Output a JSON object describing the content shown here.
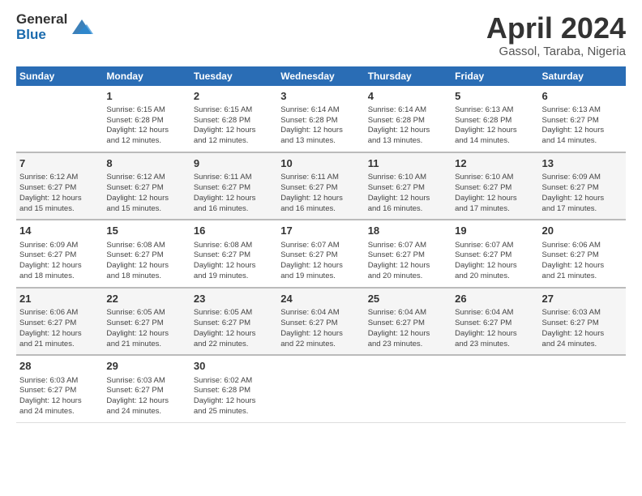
{
  "logo": {
    "general": "General",
    "blue": "Blue"
  },
  "title": "April 2024",
  "subtitle": "Gassol, Taraba, Nigeria",
  "days_header": [
    "Sunday",
    "Monday",
    "Tuesday",
    "Wednesday",
    "Thursday",
    "Friday",
    "Saturday"
  ],
  "weeks": [
    [
      {
        "num": "",
        "info": ""
      },
      {
        "num": "1",
        "info": "Sunrise: 6:15 AM\nSunset: 6:28 PM\nDaylight: 12 hours\nand 12 minutes."
      },
      {
        "num": "2",
        "info": "Sunrise: 6:15 AM\nSunset: 6:28 PM\nDaylight: 12 hours\nand 12 minutes."
      },
      {
        "num": "3",
        "info": "Sunrise: 6:14 AM\nSunset: 6:28 PM\nDaylight: 12 hours\nand 13 minutes."
      },
      {
        "num": "4",
        "info": "Sunrise: 6:14 AM\nSunset: 6:28 PM\nDaylight: 12 hours\nand 13 minutes."
      },
      {
        "num": "5",
        "info": "Sunrise: 6:13 AM\nSunset: 6:28 PM\nDaylight: 12 hours\nand 14 minutes."
      },
      {
        "num": "6",
        "info": "Sunrise: 6:13 AM\nSunset: 6:27 PM\nDaylight: 12 hours\nand 14 minutes."
      }
    ],
    [
      {
        "num": "7",
        "info": "Sunrise: 6:12 AM\nSunset: 6:27 PM\nDaylight: 12 hours\nand 15 minutes."
      },
      {
        "num": "8",
        "info": "Sunrise: 6:12 AM\nSunset: 6:27 PM\nDaylight: 12 hours\nand 15 minutes."
      },
      {
        "num": "9",
        "info": "Sunrise: 6:11 AM\nSunset: 6:27 PM\nDaylight: 12 hours\nand 16 minutes."
      },
      {
        "num": "10",
        "info": "Sunrise: 6:11 AM\nSunset: 6:27 PM\nDaylight: 12 hours\nand 16 minutes."
      },
      {
        "num": "11",
        "info": "Sunrise: 6:10 AM\nSunset: 6:27 PM\nDaylight: 12 hours\nand 16 minutes."
      },
      {
        "num": "12",
        "info": "Sunrise: 6:10 AM\nSunset: 6:27 PM\nDaylight: 12 hours\nand 17 minutes."
      },
      {
        "num": "13",
        "info": "Sunrise: 6:09 AM\nSunset: 6:27 PM\nDaylight: 12 hours\nand 17 minutes."
      }
    ],
    [
      {
        "num": "14",
        "info": "Sunrise: 6:09 AM\nSunset: 6:27 PM\nDaylight: 12 hours\nand 18 minutes."
      },
      {
        "num": "15",
        "info": "Sunrise: 6:08 AM\nSunset: 6:27 PM\nDaylight: 12 hours\nand 18 minutes."
      },
      {
        "num": "16",
        "info": "Sunrise: 6:08 AM\nSunset: 6:27 PM\nDaylight: 12 hours\nand 19 minutes."
      },
      {
        "num": "17",
        "info": "Sunrise: 6:07 AM\nSunset: 6:27 PM\nDaylight: 12 hours\nand 19 minutes."
      },
      {
        "num": "18",
        "info": "Sunrise: 6:07 AM\nSunset: 6:27 PM\nDaylight: 12 hours\nand 20 minutes."
      },
      {
        "num": "19",
        "info": "Sunrise: 6:07 AM\nSunset: 6:27 PM\nDaylight: 12 hours\nand 20 minutes."
      },
      {
        "num": "20",
        "info": "Sunrise: 6:06 AM\nSunset: 6:27 PM\nDaylight: 12 hours\nand 21 minutes."
      }
    ],
    [
      {
        "num": "21",
        "info": "Sunrise: 6:06 AM\nSunset: 6:27 PM\nDaylight: 12 hours\nand 21 minutes."
      },
      {
        "num": "22",
        "info": "Sunrise: 6:05 AM\nSunset: 6:27 PM\nDaylight: 12 hours\nand 21 minutes."
      },
      {
        "num": "23",
        "info": "Sunrise: 6:05 AM\nSunset: 6:27 PM\nDaylight: 12 hours\nand 22 minutes."
      },
      {
        "num": "24",
        "info": "Sunrise: 6:04 AM\nSunset: 6:27 PM\nDaylight: 12 hours\nand 22 minutes."
      },
      {
        "num": "25",
        "info": "Sunrise: 6:04 AM\nSunset: 6:27 PM\nDaylight: 12 hours\nand 23 minutes."
      },
      {
        "num": "26",
        "info": "Sunrise: 6:04 AM\nSunset: 6:27 PM\nDaylight: 12 hours\nand 23 minutes."
      },
      {
        "num": "27",
        "info": "Sunrise: 6:03 AM\nSunset: 6:27 PM\nDaylight: 12 hours\nand 24 minutes."
      }
    ],
    [
      {
        "num": "28",
        "info": "Sunrise: 6:03 AM\nSunset: 6:27 PM\nDaylight: 12 hours\nand 24 minutes."
      },
      {
        "num": "29",
        "info": "Sunrise: 6:03 AM\nSunset: 6:27 PM\nDaylight: 12 hours\nand 24 minutes."
      },
      {
        "num": "30",
        "info": "Sunrise: 6:02 AM\nSunset: 6:28 PM\nDaylight: 12 hours\nand 25 minutes."
      },
      {
        "num": "",
        "info": ""
      },
      {
        "num": "",
        "info": ""
      },
      {
        "num": "",
        "info": ""
      },
      {
        "num": "",
        "info": ""
      }
    ]
  ]
}
